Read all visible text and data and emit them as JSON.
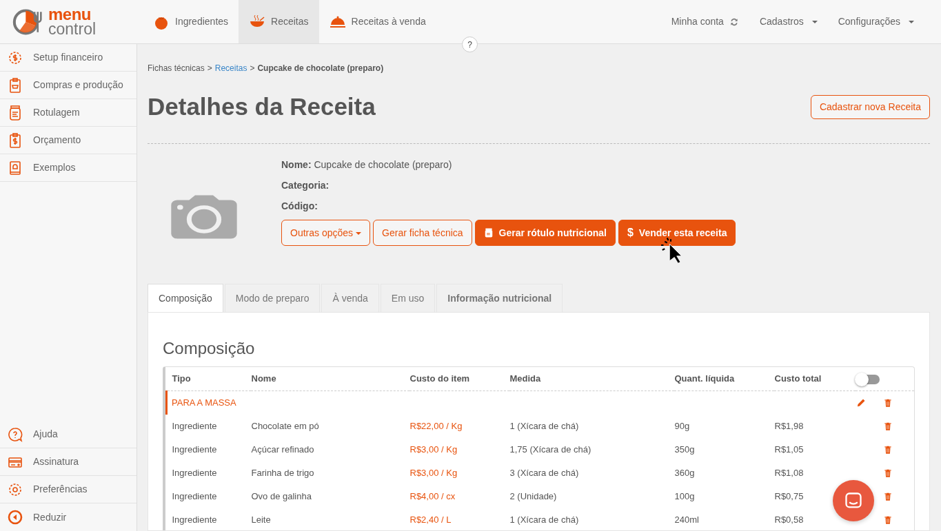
{
  "logo": {
    "line_1": "menu",
    "line_2": "control"
  },
  "top_nav": [
    {
      "label": "Ingredientes",
      "selected": false
    },
    {
      "label": "Receitas",
      "selected": true
    },
    {
      "label": "Receitas à venda",
      "selected": false
    }
  ],
  "account_menu": [
    {
      "label": "Minha conta",
      "kind": "sync"
    },
    {
      "label": "Cadastros",
      "kind": "dropdown"
    },
    {
      "label": "Configurações",
      "kind": "dropdown"
    }
  ],
  "help_button": "?",
  "sidebar": {
    "items": [
      {
        "label": "Setup financeiro"
      },
      {
        "label": "Compras e produção"
      },
      {
        "label": "Rotulagem"
      },
      {
        "label": "Orçamento"
      },
      {
        "label": "Exemplos"
      }
    ],
    "bottom_items": [
      {
        "label": "Ajuda"
      },
      {
        "label": "Assinatura"
      },
      {
        "label": "Preferências"
      },
      {
        "label": "Reduzir"
      }
    ]
  },
  "breadcrumb": [
    {
      "label": "Fichas técnicas",
      "kind": "text"
    },
    {
      "label": ">",
      "kind": "sep"
    },
    {
      "label": "Receitas",
      "kind": "link"
    },
    {
      "label": ">",
      "kind": "sep"
    },
    {
      "label": "Cupcake de chocolate (preparo)",
      "kind": "current"
    }
  ],
  "page_title": "Detalhes da Receita",
  "new_button": "Cadastrar nova Receita",
  "details": [
    {
      "label": "Nome:",
      "value": "Cupcake de chocolate (preparo)"
    },
    {
      "label": "Categoria:"
    },
    {
      "label": "Código:"
    }
  ],
  "actions": [
    {
      "label": "Outras opções",
      "kind": "dropdown"
    },
    {
      "label": "Gerar ficha técnica",
      "kind": "outline"
    },
    {
      "label": "Gerar rótulo nutricional",
      "kind": "jar"
    },
    {
      "label": "Vender esta receita",
      "kind": "dollar",
      "symbol": "$"
    }
  ],
  "tabs": [
    {
      "label": "Composição",
      "selected": true
    },
    {
      "label": "Modo de preparo",
      "selected": false
    },
    {
      "label": "À venda",
      "selected": false
    },
    {
      "label": "Em uso",
      "selected": false
    },
    {
      "label": "Informação nutricional",
      "selected": false
    }
  ],
  "section_title": "Composição",
  "table": {
    "columns": [
      "Tipo",
      "Nome",
      "Custo do item",
      "Medida",
      "Quant. líquida",
      "Custo total"
    ],
    "toggle_on": false,
    "rows": [
      {
        "kind": "group",
        "label": "PARA A MASSA"
      },
      {
        "kind": "item",
        "cells": [
          "Ingrediente",
          "Chocolate em pó",
          "R$22,00 / Kg",
          "1 (Xícara de chá)",
          "90g",
          "R$1,98"
        ]
      },
      {
        "kind": "item",
        "cells": [
          "Ingrediente",
          "Açúcar refinado",
          "R$3,00 / Kg",
          "1,75 (Xícara de chá)",
          "350g",
          "R$1,05"
        ]
      },
      {
        "kind": "item",
        "cells": [
          "Ingrediente",
          "Farinha de trigo",
          "R$3,00 / Kg",
          "3 (Xícara de chá)",
          "360g",
          "R$1,08"
        ]
      },
      {
        "kind": "item",
        "cells": [
          "Ingrediente",
          "Ovo de galinha",
          "R$4,00 / cx",
          "2 (Unidade)",
          "100g",
          "R$0,75"
        ]
      },
      {
        "kind": "item",
        "cells": [
          "Ingrediente",
          "Leite",
          "R$2,40 / L",
          "1 (Xícara de chá)",
          "240ml",
          "R$0,58"
        ]
      }
    ]
  }
}
